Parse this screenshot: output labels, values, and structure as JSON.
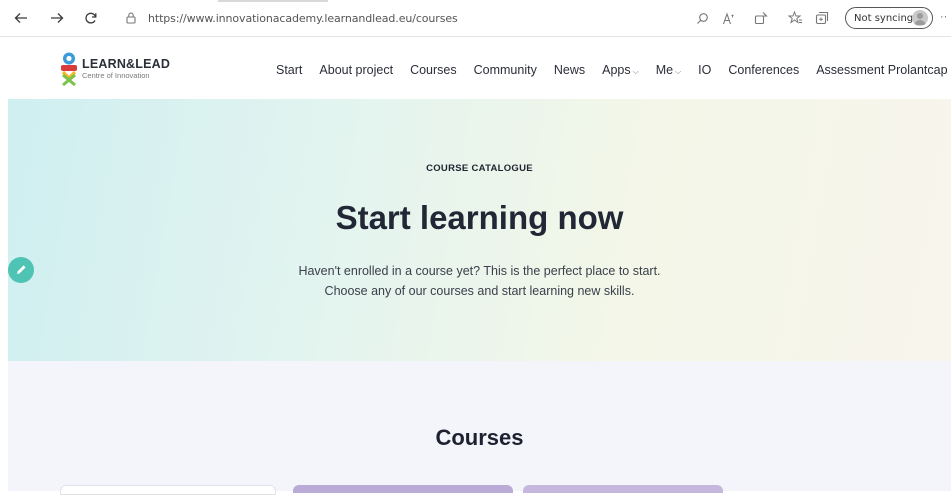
{
  "browser": {
    "url": "https://www.innovationacademy.learnandlead.eu/courses",
    "sync_label": "Not syncing"
  },
  "site": {
    "logo_title": "LEARN&LEAD",
    "logo_subtitle": "Centre of Innovation",
    "nav": [
      {
        "label": "Start"
      },
      {
        "label": "About project"
      },
      {
        "label": "Courses"
      },
      {
        "label": "Community"
      },
      {
        "label": "News"
      },
      {
        "label": "Apps"
      },
      {
        "label": "Me"
      },
      {
        "label": "IO"
      },
      {
        "label": "Conferences"
      },
      {
        "label": "Assessment Prolantcap"
      }
    ]
  },
  "hero": {
    "kicker": "COURSE CATALOGUE",
    "title": "Start learning now",
    "line1": "Haven't enrolled in a course yet? This is the perfect place to start.",
    "line2": "Choose any of our courses and start learning new skills."
  },
  "courses": {
    "heading": "Courses"
  },
  "colors": {
    "accent_teal": "#4fc3b4",
    "hero_gradient_start": "#cfeff1",
    "hero_gradient_end": "#f8f5ec"
  }
}
